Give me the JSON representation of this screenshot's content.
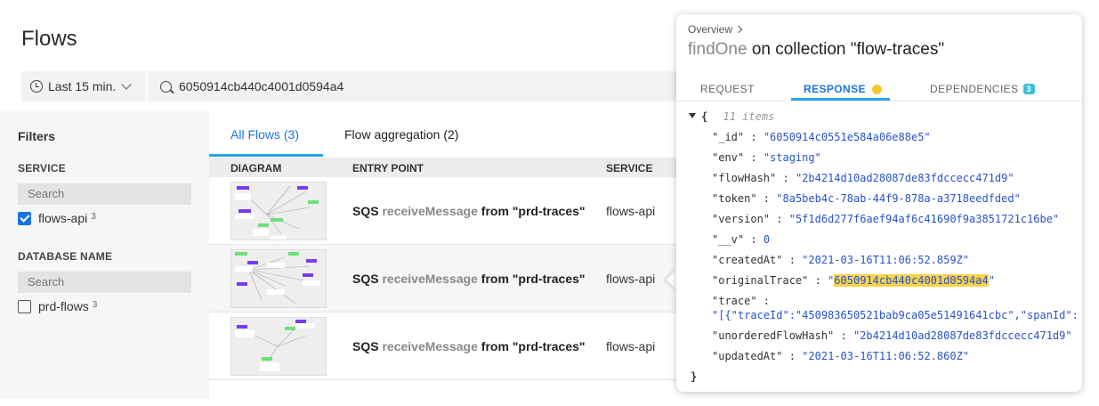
{
  "page": {
    "title": "Flows"
  },
  "time_range": {
    "label": "Last 15 min."
  },
  "search": {
    "value": "6050914cb440c4001d0594a4"
  },
  "sidebar": {
    "title": "Filters",
    "service": {
      "title": "SERVICE",
      "search_placeholder": "Search",
      "options": [
        {
          "label": "flows-api",
          "count": "3",
          "checked": true
        }
      ]
    },
    "database": {
      "title": "DATABASE NAME",
      "search_placeholder": "Search",
      "options": [
        {
          "label": "prd-flows",
          "count": "3",
          "checked": false
        }
      ]
    }
  },
  "tabs": [
    {
      "label": "All Flows (3)",
      "active": true
    },
    {
      "label": "Flow aggregation (2)",
      "active": false
    }
  ],
  "table": {
    "columns": [
      "DIAGRAM",
      "ENTRY POINT",
      "SERVICE"
    ],
    "rows": [
      {
        "entry_prefix": "SQS",
        "entry_op": "receiveMessage",
        "entry_suffix": "from \"prd-traces\"",
        "service": "flows-api"
      },
      {
        "entry_prefix": "SQS",
        "entry_op": "receiveMessage",
        "entry_suffix": "from \"prd-traces\"",
        "service": "flows-api"
      },
      {
        "entry_prefix": "SQS",
        "entry_op": "receiveMessage",
        "entry_suffix": "from \"prd-traces\"",
        "service": "flows-api"
      }
    ]
  },
  "popover": {
    "breadcrumb": "Overview",
    "title_fn": "findOne",
    "title_rest": "on collection \"flow-traces\"",
    "tabs": [
      {
        "label": "REQUEST"
      },
      {
        "label": "RESPONSE",
        "active": true
      },
      {
        "label": "DEPENDENCIES",
        "badge": "3"
      }
    ],
    "json": {
      "open": "{",
      "meta": "11 items",
      "close": "}",
      "fields": [
        {
          "key": "\"_id\"",
          "value": "\"6050914c0551e584a06e88e5\""
        },
        {
          "key": "\"env\"",
          "value": "\"staging\""
        },
        {
          "key": "\"flowHash\"",
          "value": "\"2b4214d10ad28087de83fdccecc471d9\""
        },
        {
          "key": "\"token\"",
          "value": "\"8a5beb4c-78ab-44f9-878a-a3718eedfded\""
        },
        {
          "key": "\"version\"",
          "value": "\"5f1d6d277f6aef94af6c41690f9a3851721c16be\""
        },
        {
          "key": "\"__v\"",
          "value": "0"
        },
        {
          "key": "\"createdAt\"",
          "value": "\"2021-03-16T11:06:52.859Z\""
        },
        {
          "key": "\"originalTrace\"",
          "value_pre": "\"",
          "value_hl": "6050914cb440c4001d0594a4",
          "value_post": "\""
        },
        {
          "key": "\"trace\"",
          "value": "\"[{\"traceId\":\"450983650521bab9ca05e51491641cbc\",\"spanId\":"
        },
        {
          "key": "\"unorderedFlowHash\"",
          "value": "\"2b4214d10ad28087de83fdccecc471d9\""
        },
        {
          "key": "\"updatedAt\"",
          "value": "\"2021-03-16T11:06:52.860Z\""
        }
      ]
    }
  },
  "colors": {
    "accent": "#1a73e8",
    "tab_underline": "#29a3e8",
    "json_value": "#2953c8",
    "highlight": "#f6d24a",
    "badge": "#3cbfd8"
  }
}
